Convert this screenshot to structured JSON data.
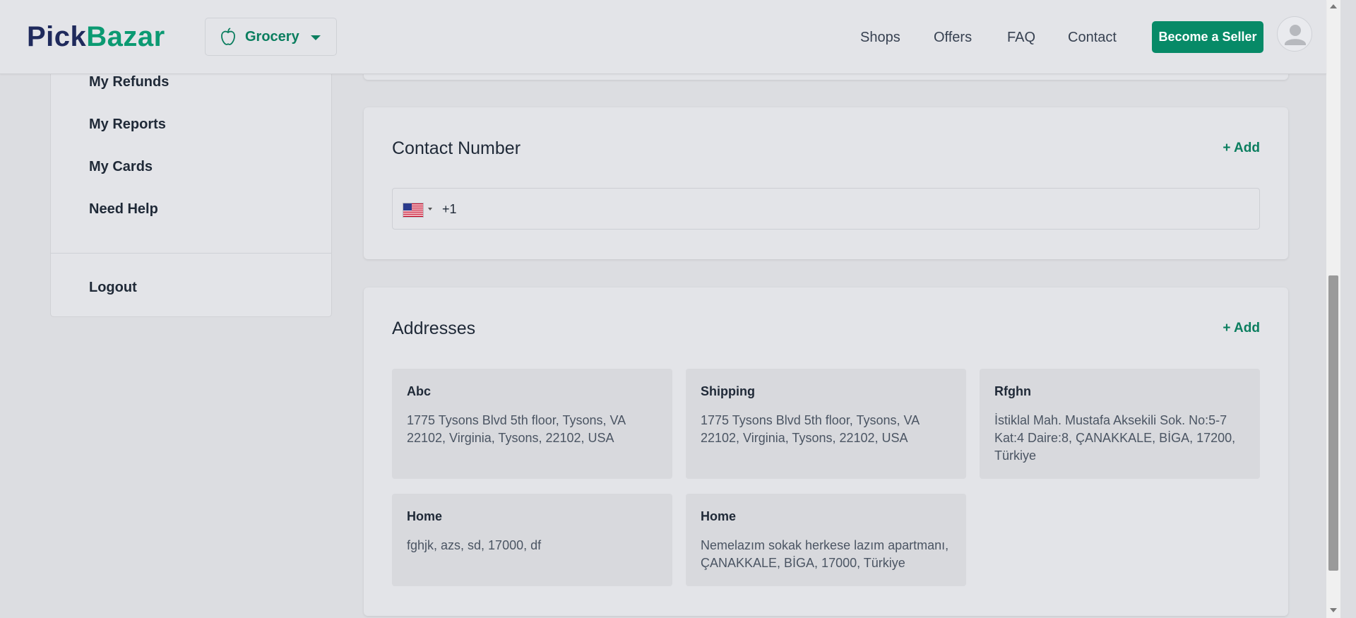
{
  "header": {
    "logo_part1": "Pick",
    "logo_part2": "Bazar",
    "category": "Grocery",
    "nav": [
      "Shops",
      "Offers",
      "FAQ",
      "Contact"
    ],
    "seller_button": "Become a Seller"
  },
  "sidebar": {
    "items": [
      "My Refunds",
      "My Reports",
      "My Cards",
      "Need Help"
    ],
    "logout": "Logout"
  },
  "contact": {
    "title": "Contact Number",
    "add_label": "+ Add",
    "dial_code": "+1",
    "country_flag": "us-flag-icon"
  },
  "addresses": {
    "title": "Addresses",
    "add_label": "+ Add",
    "items": [
      {
        "title": "Abc",
        "detail": "1775 Tysons Blvd 5th floor, Tysons, VA 22102, Virginia, Tysons, 22102, USA"
      },
      {
        "title": "Shipping",
        "detail": "1775 Tysons Blvd 5th floor, Tysons, VA 22102, Virginia, Tysons, 22102, USA"
      },
      {
        "title": "Rfghn",
        "detail": "İstiklal Mah. Mustafa Aksekili Sok. No:5-7 Kat:4 Daire:8, ÇANAKKALE, BİGA, 17200, Türkiye"
      },
      {
        "title": "Home",
        "detail": "fghjk, azs, sd, 17000, df"
      },
      {
        "title": "Home",
        "detail": "Nemelazım sokak herkese lazım apartmanı, ÇANAKKALE, BİGA, 17000, Türkiye"
      }
    ]
  },
  "colors": {
    "accent": "#078a67",
    "logo_dark": "#1f2a5c",
    "logo_green": "#0b9a72",
    "page_bg": "#dcdde1",
    "card_bg": "#e3e4e8"
  }
}
